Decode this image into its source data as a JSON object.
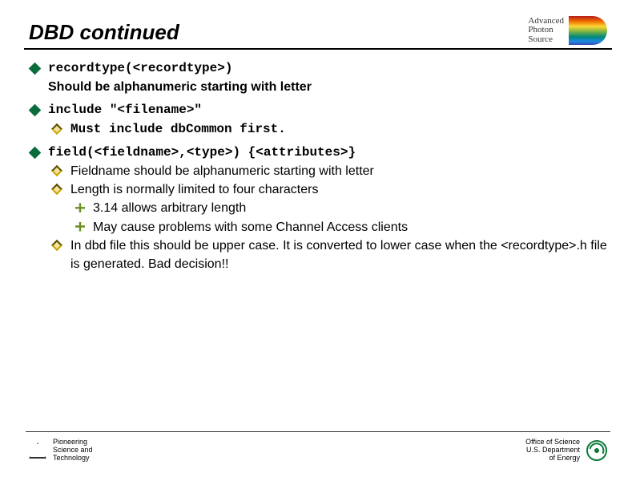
{
  "title": "DBD continued",
  "logo": {
    "line1": "Advanced",
    "line2": "Photon",
    "line3": "Source"
  },
  "bullets": [
    {
      "code": "recordtype(<recordtype>)",
      "desc": "Should be alphanumeric starting with letter"
    },
    {
      "code": "include \"<filename>\"",
      "children": [
        {
          "type": "mono",
          "text": "Must include dbCommon first."
        }
      ]
    },
    {
      "code": "field(<fieldname>,<type>) {<attributes>}",
      "children": [
        {
          "type": "text",
          "text": "Fieldname should be alphanumeric starting with letter"
        },
        {
          "type": "text",
          "text": "Length is normally limited to four characters",
          "children": [
            {
              "text": "3.14 allows arbitrary length"
            },
            {
              "text": "May cause problems with some Channel Access clients"
            }
          ]
        },
        {
          "type": "text",
          "text": "In dbd file this should be upper case. It is converted to lower case when the <recordtype>.h file is generated. Bad decision!!"
        }
      ]
    }
  ],
  "footer": {
    "left": {
      "l1": "Pioneering",
      "l2": "Science and",
      "l3": "Technology"
    },
    "right": {
      "l1": "Office of Science",
      "l2": "U.S. Department",
      "l3": "of Energy"
    }
  }
}
